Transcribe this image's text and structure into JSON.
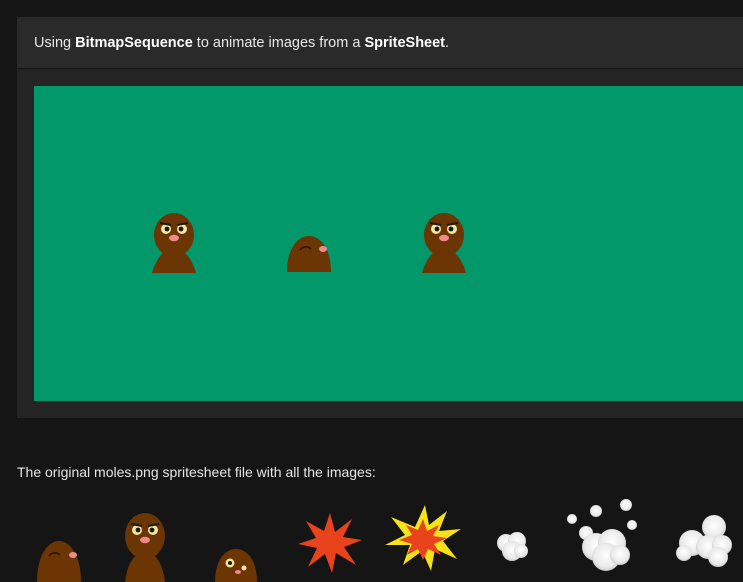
{
  "demo": {
    "caption_prefix": "Using ",
    "caption_bold_1": "BitmapSequence",
    "caption_middle": " to animate images from a ",
    "caption_bold_2": "SpriteSheet",
    "caption_suffix": ".",
    "stage_color": "#02986a",
    "moles": [
      {
        "state": "up"
      },
      {
        "state": "peek"
      },
      {
        "state": "up"
      }
    ]
  },
  "spritesheet": {
    "caption": "The original moles.png spritesheet file with all the images:",
    "frames": [
      {
        "name": "mole-peek"
      },
      {
        "name": "mole-up"
      },
      {
        "name": "mole-hit"
      },
      {
        "name": "explosion-red"
      },
      {
        "name": "explosion-yellow"
      },
      {
        "name": "smoke-small"
      },
      {
        "name": "smoke-large"
      },
      {
        "name": "smoke-cluster"
      }
    ]
  },
  "colors": {
    "background": "#151515",
    "panel": "#242424",
    "stage": "#02986a",
    "mole_body": "#6b3504",
    "mole_cheek": "#f08a8a",
    "explosion_red": "#e8431c",
    "explosion_yellow": "#f7e219",
    "smoke": "#f2f2f2"
  }
}
